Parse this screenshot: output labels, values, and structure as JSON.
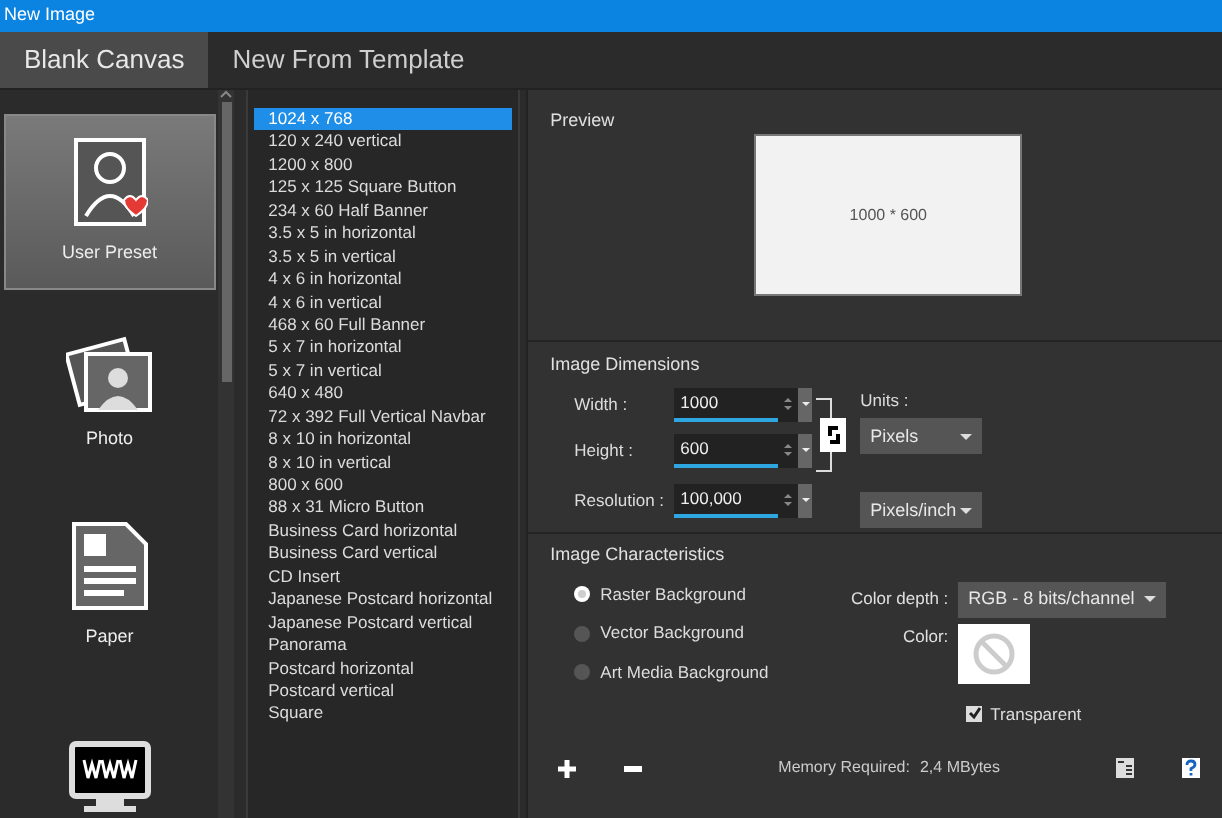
{
  "window": {
    "title": "New Image"
  },
  "tabs": [
    {
      "label": "Blank Canvas",
      "selected": true
    },
    {
      "label": "New From Template",
      "selected": false
    }
  ],
  "categories": [
    {
      "label": "User Preset",
      "kind": "user",
      "selected": true
    },
    {
      "label": "Photo",
      "kind": "photo",
      "selected": false
    },
    {
      "label": "Paper",
      "kind": "paper",
      "selected": false
    },
    {
      "kind": "web",
      "selected": false
    }
  ],
  "presets": [
    {
      "label": "1024 x 768",
      "selected": true
    },
    {
      "label": "120 x 240 vertical",
      "selected": false
    },
    {
      "label": "1200 x 800",
      "selected": false
    },
    {
      "label": "125 x 125 Square Button",
      "selected": false
    },
    {
      "label": "234 x 60 Half Banner",
      "selected": false
    },
    {
      "label": "3.5 x 5 in horizontal",
      "selected": false
    },
    {
      "label": "3.5 x 5 in vertical",
      "selected": false
    },
    {
      "label": "4 x 6 in horizontal",
      "selected": false
    },
    {
      "label": "4 x 6 in vertical",
      "selected": false
    },
    {
      "label": "468 x 60 Full Banner",
      "selected": false
    },
    {
      "label": "5 x 7 in horizontal",
      "selected": false
    },
    {
      "label": "5 x 7 in vertical",
      "selected": false
    },
    {
      "label": "640 x 480",
      "selected": false
    },
    {
      "label": "72 x 392 Full Vertical Navbar",
      "selected": false
    },
    {
      "label": "8 x 10 in horizontal",
      "selected": false
    },
    {
      "label": "8 x 10 in vertical",
      "selected": false
    },
    {
      "label": "800 x 600",
      "selected": false
    },
    {
      "label": "88 x 31 Micro Button",
      "selected": false
    },
    {
      "label": "Business Card horizontal",
      "selected": false
    },
    {
      "label": "Business Card vertical",
      "selected": false
    },
    {
      "label": "CD Insert",
      "selected": false
    },
    {
      "label": "Japanese Postcard horizontal",
      "selected": false
    },
    {
      "label": "Japanese Postcard vertical",
      "selected": false
    },
    {
      "label": "Panorama",
      "selected": false
    },
    {
      "label": "Postcard horizontal",
      "selected": false
    },
    {
      "label": "Postcard vertical",
      "selected": false
    },
    {
      "label": "Square",
      "selected": false
    }
  ],
  "preview": {
    "title": "Preview",
    "caption": "1000 * 600"
  },
  "dimensions": {
    "title": "Image Dimensions",
    "fields": [
      {
        "label": "Width :",
        "value": "1000"
      },
      {
        "label": "Height :",
        "value": "600"
      },
      {
        "label": "Resolution :",
        "value": "100,000"
      }
    ],
    "units_label": "Units :",
    "units": "Pixels",
    "resolution_units": "Pixels/inch"
  },
  "characteristics": {
    "title": "Image Characteristics",
    "backgrounds": [
      {
        "label": "Raster Background",
        "selected": true
      },
      {
        "label": "Vector Background",
        "selected": false
      },
      {
        "label": "Art Media Background",
        "selected": false
      }
    ],
    "color_depth_label": "Color depth :",
    "color_depth": "RGB - 8 bits/channel",
    "color_label": "Color:",
    "transparent": {
      "label": "Transparent",
      "checked": true
    }
  },
  "footer": {
    "memory_label": "Memory Required:",
    "memory_value": "2,4 MBytes"
  }
}
